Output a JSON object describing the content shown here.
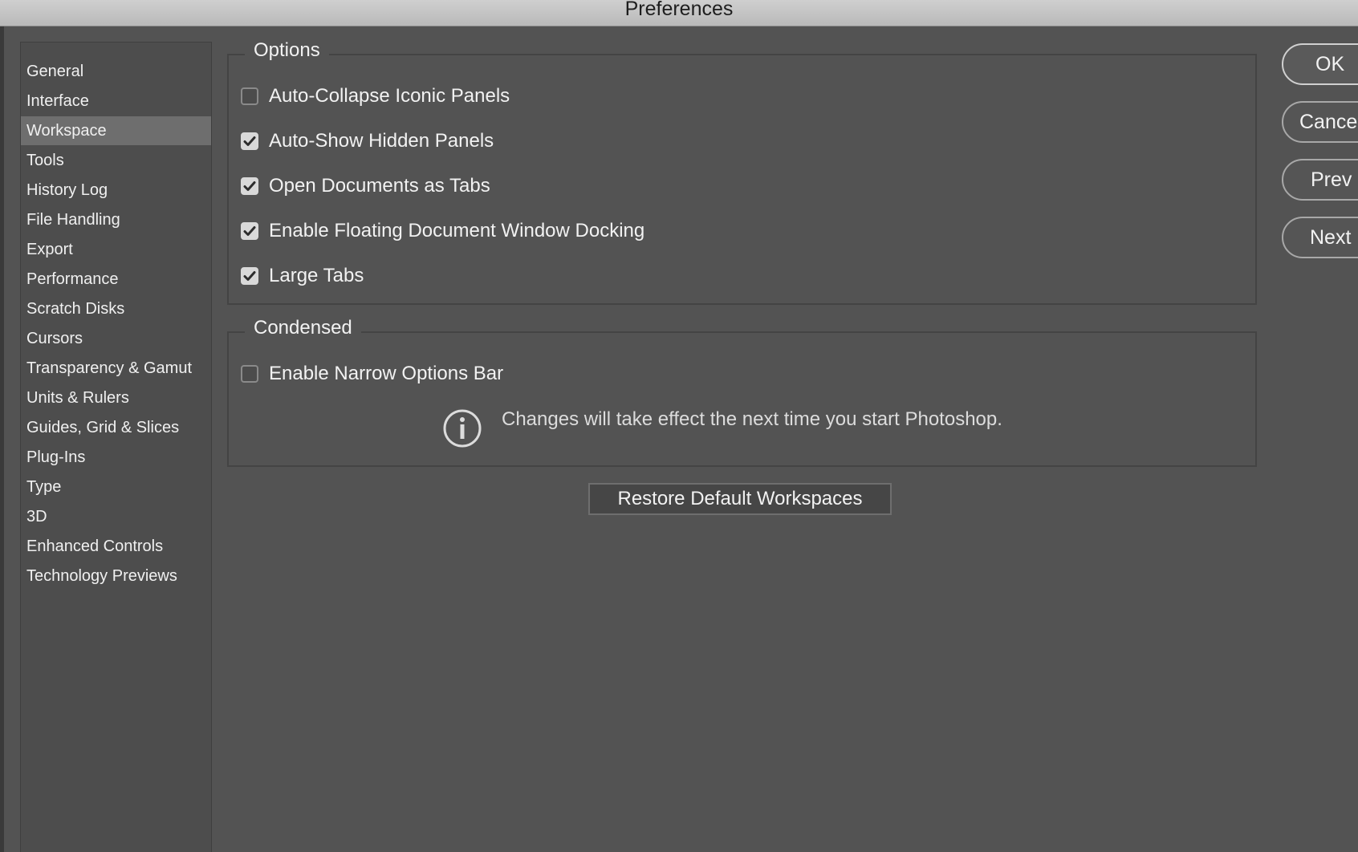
{
  "window": {
    "title": "Preferences"
  },
  "sidebar": {
    "selected": "Workspace",
    "items": [
      {
        "label": "General"
      },
      {
        "label": "Interface"
      },
      {
        "label": "Workspace"
      },
      {
        "label": "Tools"
      },
      {
        "label": "History Log"
      },
      {
        "label": "File Handling"
      },
      {
        "label": "Export"
      },
      {
        "label": "Performance"
      },
      {
        "label": "Scratch Disks"
      },
      {
        "label": "Cursors"
      },
      {
        "label": "Transparency & Gamut"
      },
      {
        "label": "Units & Rulers"
      },
      {
        "label": "Guides, Grid & Slices"
      },
      {
        "label": "Plug-Ins"
      },
      {
        "label": "Type"
      },
      {
        "label": "3D"
      },
      {
        "label": "Enhanced Controls"
      },
      {
        "label": "Technology Previews"
      }
    ]
  },
  "options": {
    "title": "Options",
    "items": [
      {
        "label": "Auto-Collapse Iconic Panels",
        "checked": false
      },
      {
        "label": "Auto-Show Hidden Panels",
        "checked": true
      },
      {
        "label": "Open Documents as Tabs",
        "checked": true
      },
      {
        "label": "Enable Floating Document Window Docking",
        "checked": true
      },
      {
        "label": "Large Tabs",
        "checked": true
      }
    ]
  },
  "condensed": {
    "title": "Condensed",
    "items": [
      {
        "label": "Enable Narrow Options Bar",
        "checked": false
      }
    ],
    "info_icon": "info-icon",
    "info_text": "Changes will take effect the next time you start Photoshop."
  },
  "restore_button": {
    "label": "Restore Default Workspaces"
  },
  "buttons": {
    "ok": "OK",
    "cancel": "Cancel",
    "prev": "Prev",
    "next": "Next"
  },
  "colors": {
    "background": "#535353",
    "sidebar_background": "#4d4d4d",
    "selected_item": "#6e6e6e",
    "titlebar": "#c4c4c4",
    "text": "#f2f2f2"
  }
}
